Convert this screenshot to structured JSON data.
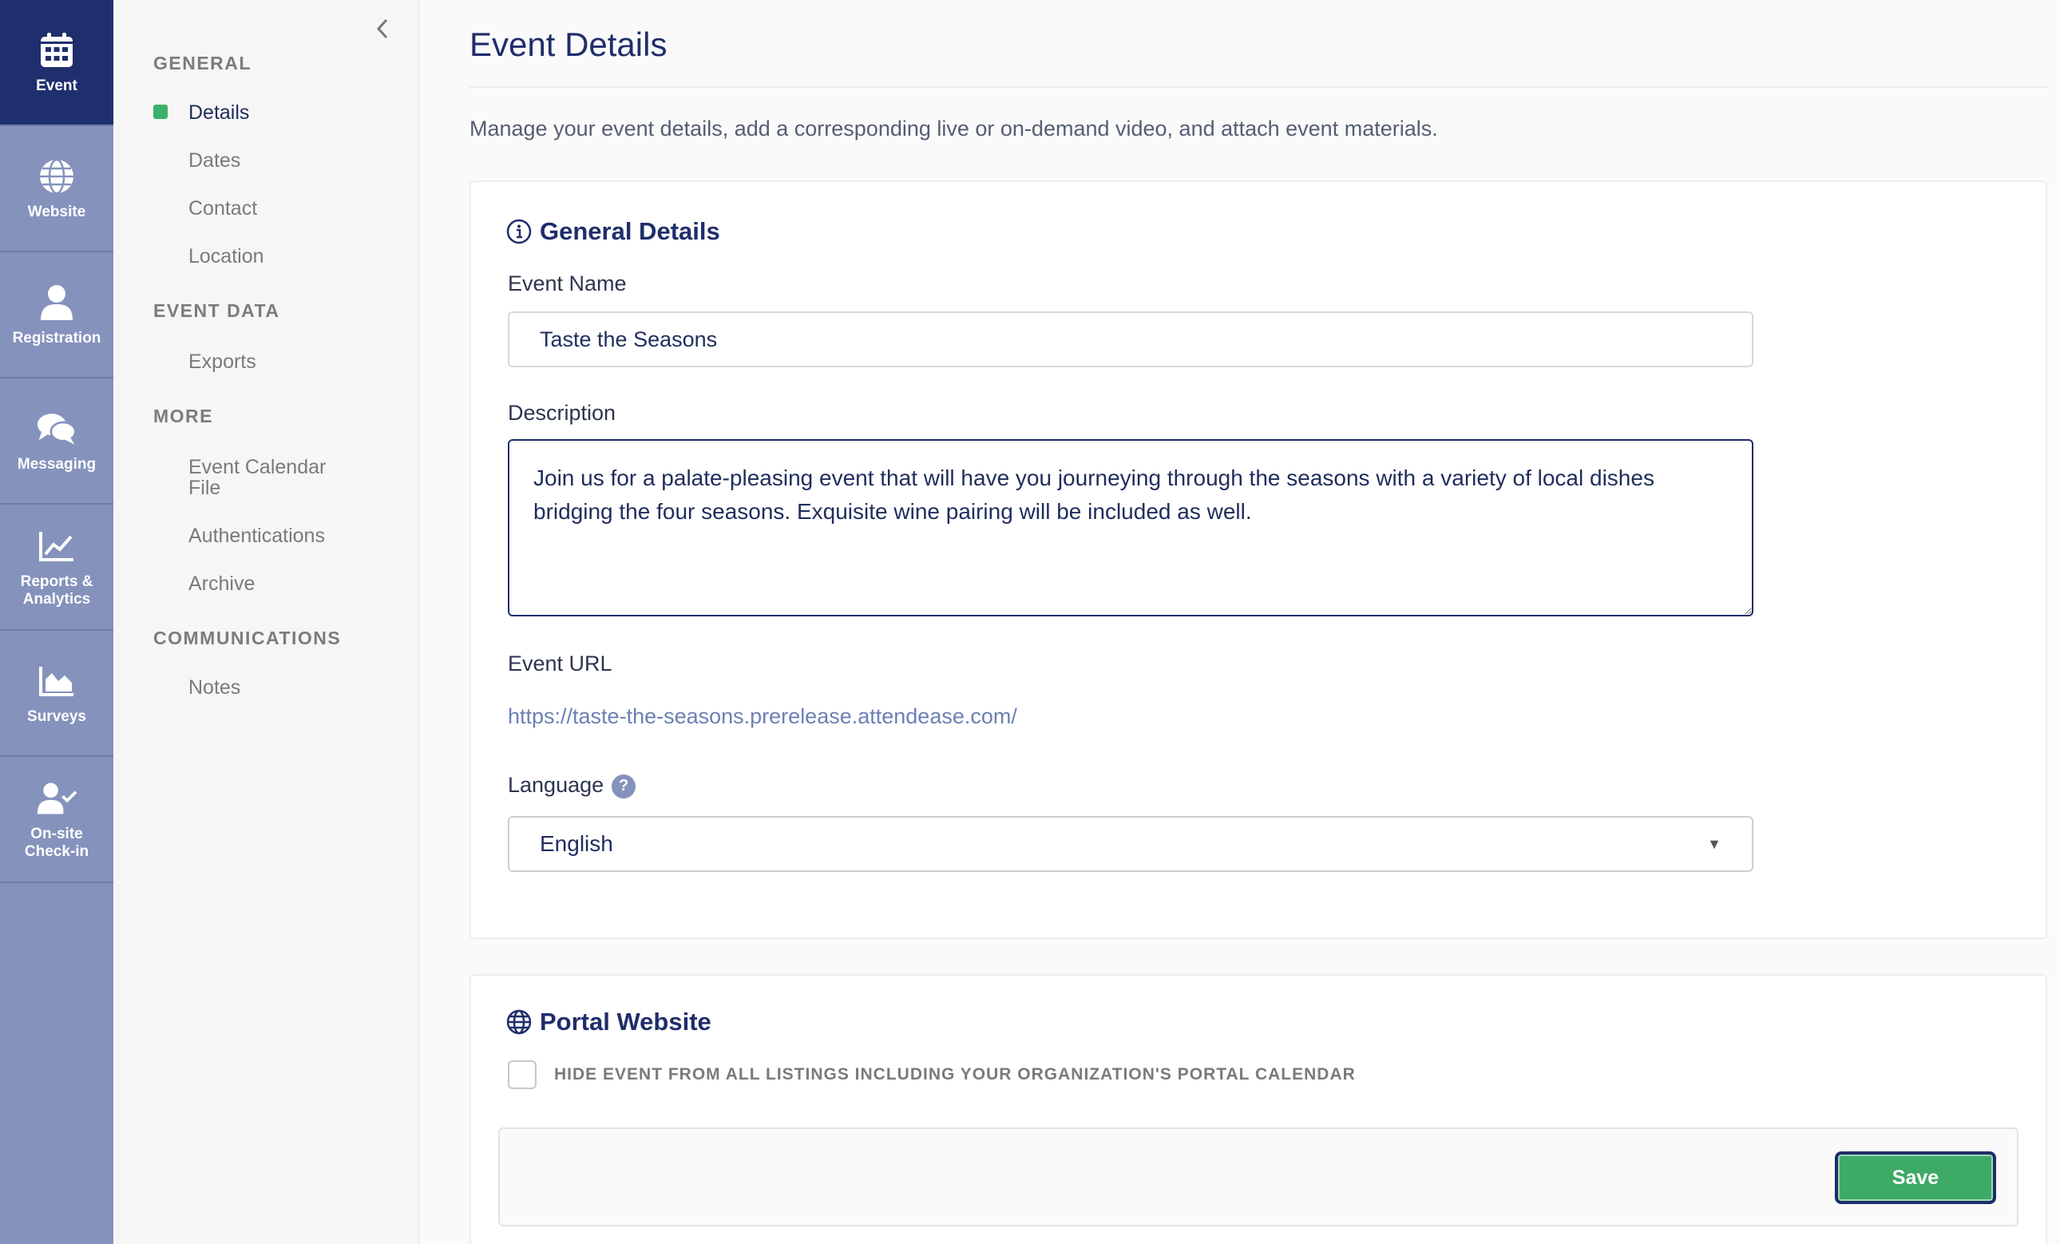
{
  "rail": {
    "items": [
      {
        "label": "Event",
        "icon": "calendar-icon",
        "active": true
      },
      {
        "label": "Website",
        "icon": "globe-icon"
      },
      {
        "label": "Registration",
        "icon": "person-icon"
      },
      {
        "label": "Messaging",
        "icon": "chat-icon"
      },
      {
        "label": "Reports & Analytics",
        "icon": "line-chart-icon"
      },
      {
        "label": "Surveys",
        "icon": "area-chart-icon"
      },
      {
        "label": "On-site Check-in",
        "icon": "user-check-icon"
      }
    ]
  },
  "subnav": {
    "sections": [
      {
        "title": "GENERAL",
        "items": [
          "Details",
          "Dates",
          "Contact",
          "Location"
        ]
      },
      {
        "title": "EVENT DATA",
        "items": [
          "Exports"
        ]
      },
      {
        "title": "MORE",
        "items": [
          "Event Calendar File",
          "Authentications",
          "Archive"
        ]
      },
      {
        "title": "COMMUNICATIONS",
        "items": [
          "Notes"
        ]
      }
    ],
    "active_item": "Details",
    "active_color": "#3cb169"
  },
  "main": {
    "title": "Event Details",
    "description": "Manage your event details, add a corresponding live or on-demand video, and attach event materials.",
    "general": {
      "heading": "General Details",
      "event_name_label": "Event Name",
      "event_name_value": "Taste the Seasons",
      "description_label": "Description",
      "description_value": "Join us for a palate-pleasing event that will have you journeying through the seasons with a variety of local dishes bridging the four seasons. Exquisite wine pairing will be included as well.",
      "url_label": "Event URL",
      "url_value": "https://taste-the-seasons.prerelease.attendease.com/",
      "language_label": "Language",
      "language_help": "?",
      "language_value": "English"
    },
    "portal": {
      "heading": "Portal Website",
      "hide_label": "HIDE EVENT FROM ALL LISTINGS INCLUDING YOUR ORGANIZATION'S PORTAL CALENDAR"
    },
    "save_label": "Save"
  },
  "colors": {
    "rail_bg": "#8592bc",
    "rail_active": "#1f2f6e",
    "save_green": "#3daa65",
    "link": "#6c80b5"
  }
}
